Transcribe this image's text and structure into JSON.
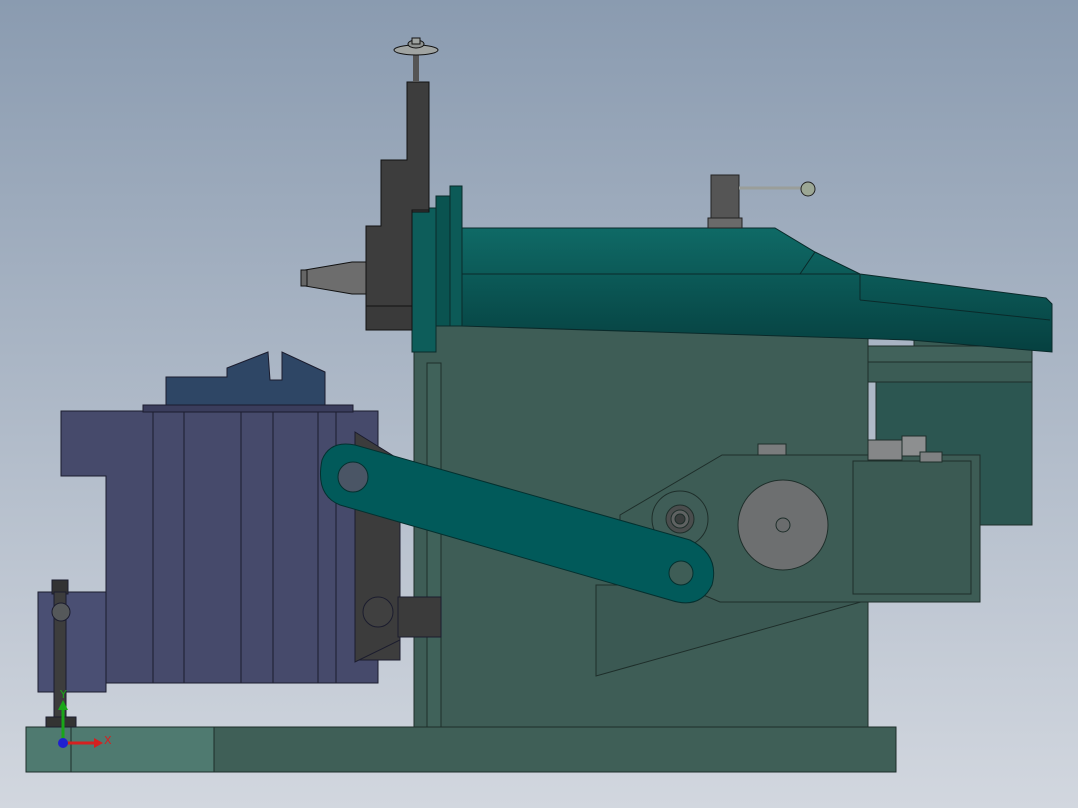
{
  "viewport": {
    "background_top": "#8a9bb0",
    "background_bottom": "#d2d7df"
  },
  "model": {
    "colors": {
      "ram_teal": "#0c5a5a",
      "ram_teal_dark": "#074545",
      "body_green": "#3e5d56",
      "body_green_light": "#4a6d66",
      "base_green": "#3f5f57",
      "vise_navy": "#464a6b",
      "vise_navy_dark": "#3a3d5c",
      "table_blue": "#2e4665",
      "dark_gray": "#3d3d3d",
      "mid_gray": "#6a6a6a",
      "light_gray": "#a0a4a2",
      "rocker_teal": "#015a5a",
      "gear_gray": "#6d6f70",
      "side_panel": "#2c5651"
    }
  },
  "triad": {
    "x_label": "X",
    "y_label": "Y",
    "x_color": "#d62020",
    "y_color": "#19a619",
    "z_color": "#2020d0"
  }
}
